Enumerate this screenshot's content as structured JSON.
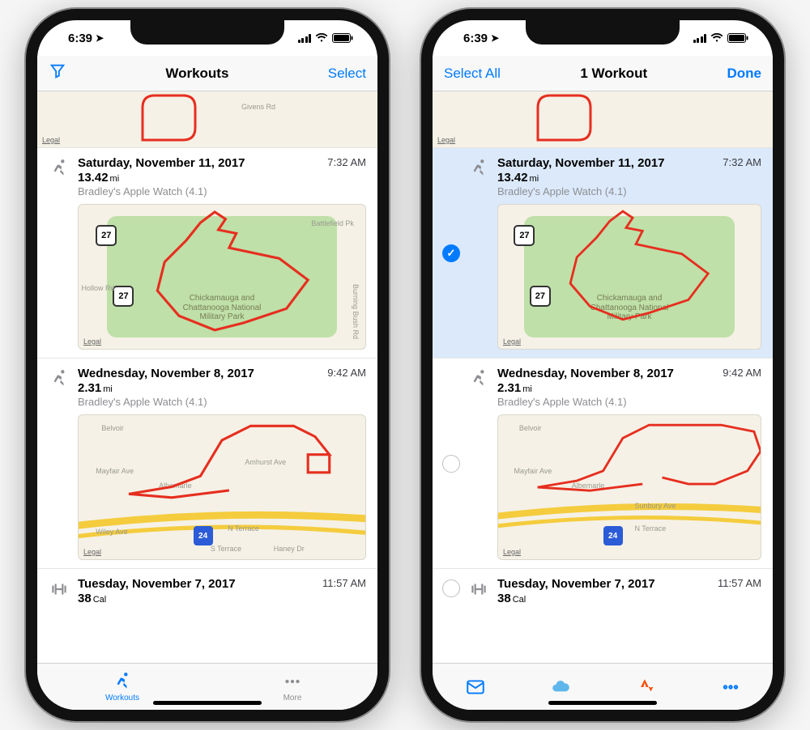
{
  "status": {
    "time": "6:39",
    "loc_arrow": "↗"
  },
  "phoneA": {
    "nav": {
      "title": "Workouts",
      "right": "Select"
    },
    "tabs": {
      "workouts": "Workouts",
      "more": "More"
    }
  },
  "phoneB": {
    "nav": {
      "left": "Select All",
      "title": "1 Workout",
      "right": "Done"
    }
  },
  "workouts": [
    {
      "date": "Saturday, November 11, 2017",
      "time": "7:32 AM",
      "distance": "13.42",
      "unit": "mi",
      "device": "Bradley's Apple Watch (4.1)",
      "map": {
        "park_name": "Chickamauga and Chattanooga National Military Park",
        "legal": "Legal",
        "labels": {
          "givens": "Givens Rd",
          "battlefield": "Battlefield Pk",
          "burning": "Burning Bush Rd",
          "hollow": "Hollow Rd"
        },
        "route_name": "27"
      }
    },
    {
      "date": "Wednesday, November 8, 2017",
      "time": "9:42 AM",
      "distance": "2.31",
      "unit": "mi",
      "device": "Bradley's Apple Watch (4.1)",
      "map": {
        "legal": "Legal",
        "labels": {
          "belvoir": "Belvoir",
          "mayfair": "Mayfair Ave",
          "albemarle": "Albemarle",
          "wiley": "Wiley Ave",
          "nterrace": "N Terrace",
          "sterrace": "S Terrace",
          "sunbury": "Sunbury Ave",
          "haney": "Haney Dr",
          "amhurst": "Amhurst Ave"
        },
        "interstate": "24"
      }
    },
    {
      "date": "Tuesday, November 7, 2017",
      "time": "11:57 AM",
      "distance": "38",
      "unit_extra": "Cal"
    }
  ],
  "colors": {
    "accent": "#007aff",
    "route": "#e62e1f",
    "strava": "#fc4c02"
  }
}
